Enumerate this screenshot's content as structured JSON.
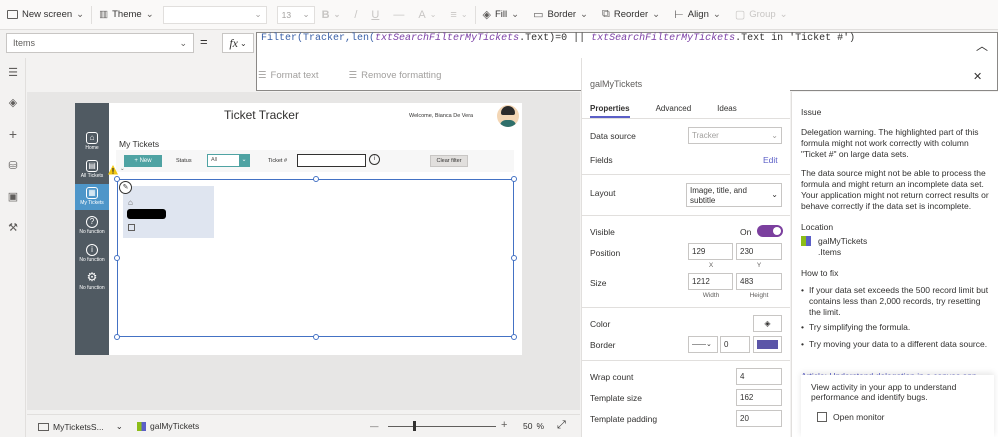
{
  "toolbar": {
    "new_screen": "New screen",
    "theme": "Theme",
    "font_size": "13",
    "bold": "B",
    "italic": "/",
    "underline": "U",
    "fill": "Fill",
    "border": "Border",
    "reorder": "Reorder",
    "align": "Align",
    "group": "Group"
  },
  "formula_bar": {
    "property": "Items",
    "equals": "=",
    "fx": "fx",
    "formula": {
      "p1": "Filter(",
      "p2": "Tracker",
      "p3": ",len(",
      "p4": "txtSearchFilterMyTickets",
      "p5": ".Text)=0 || ",
      "p6": "txtSearchFilterMyTickets",
      "p7": ".Text in 'Ticket #')"
    },
    "format_text": "Format text",
    "remove_formatting": "Remove formatting"
  },
  "app": {
    "title": "Ticket Tracker",
    "welcome": "Welcome, Bianca De Vera",
    "nav": [
      {
        "label": "Home",
        "icon": "home-icon"
      },
      {
        "label": "All Tickets",
        "icon": "trash-icon"
      },
      {
        "label": "My Tickets",
        "icon": "tickets-icon"
      },
      {
        "label": "No function",
        "icon": "question-icon"
      },
      {
        "label": "No function",
        "icon": "info-icon"
      },
      {
        "label": "No function",
        "icon": "gear-icon"
      }
    ],
    "section_title": "My Tickets",
    "new_button": "+ New",
    "status_label": "Status",
    "status_value": "All",
    "ticket_label": "Ticket #",
    "info_glyph": "i",
    "clear_filter": "Clear filter"
  },
  "bottom": {
    "screen": "MyTicketsS...",
    "control": "galMyTickets",
    "zoom_minus": "—",
    "zoom_plus": "+",
    "zoom": "50",
    "zoom_unit": "%"
  },
  "right_panel": {
    "control_name": "galMyTickets",
    "tabs": [
      "Properties",
      "Advanced",
      "Ideas"
    ],
    "data_source_label": "Data source",
    "data_source_value": "Tracker",
    "fields_label": "Fields",
    "fields_edit": "Edit",
    "layout_label": "Layout",
    "layout_value": "Image, title, and subtitle",
    "visible_label": "Visible",
    "visible_value": "On",
    "position_label": "Position",
    "position_x": "129",
    "position_y": "230",
    "x_label": "X",
    "y_label": "Y",
    "size_label": "Size",
    "size_w": "1212",
    "size_h": "483",
    "width_label": "Width",
    "height_label": "Height",
    "color_label": "Color",
    "border_label": "Border",
    "border_width": "0",
    "border_color": "#5b55a8",
    "wrap_count_label": "Wrap count",
    "wrap_count": "4",
    "template_size_label": "Template size",
    "template_size": "162",
    "template_padding_label": "Template padding",
    "template_padding": "20"
  },
  "issue": {
    "heading": "Issue",
    "p1": "Delegation warning. The highlighted part of this formula might not work correctly with column \"Ticket #\" on large data sets.",
    "p2": "The data source might not be able to process the formula and might return an incomplete data set. Your application might not return correct results or behave correctly if the data set is incomplete.",
    "location_heading": "Location",
    "location_control": "galMyTickets",
    "location_prop": ".Items",
    "fix_heading": "How to fix",
    "fix": [
      "If your data set exceeds the 500 record limit but contains less than 2,000 records, try resetting the limit.",
      "Try simplifying the formula.",
      "Try moving your data to a different data source."
    ],
    "article": "Article: Understand delegation in a canvas app",
    "monitor_text": "View activity in your app to understand performance and identify bugs.",
    "monitor_button": "Open monitor"
  },
  "colors": {
    "accent": "#5b5fc7",
    "app_nav": "#505a62",
    "app_teal": "#4fa3a3",
    "selection": "#4472c4"
  }
}
